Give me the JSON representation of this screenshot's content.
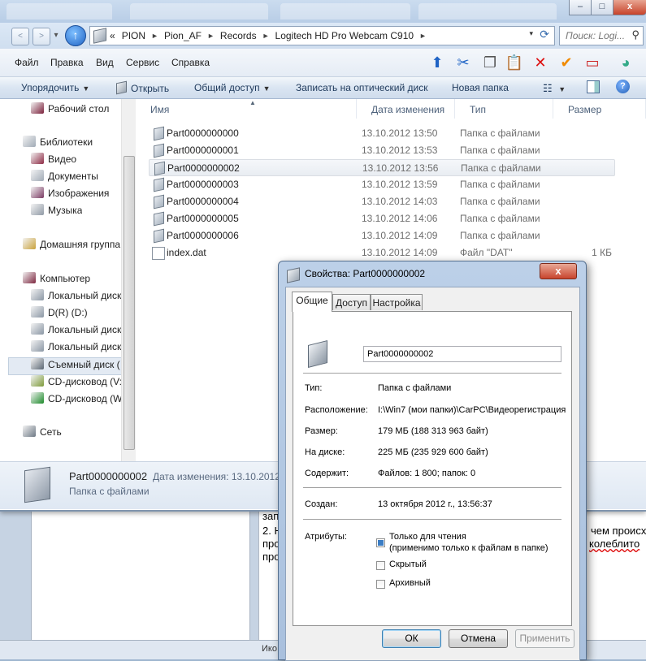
{
  "background_doc": {
    "lines": [
      {
        "text": "зап"
      },
      {
        "text": "2. Н"
      },
      {
        "text": "про"
      },
      {
        "text": "про"
      },
      {
        "text": "чем происх"
      },
      {
        "text": "колеблито"
      }
    ],
    "bottom_snippet": "Ико"
  },
  "window": {
    "caption_buttons": {
      "minimize": "–",
      "maximize": "□",
      "close": "x"
    }
  },
  "address_bar": {
    "back": "<",
    "forward": ">",
    "up": "↑",
    "overflow": "«",
    "crumbs": [
      "PION",
      "Pion_AF",
      "Records",
      "Logitech HD Pro Webcam C910"
    ],
    "search_placeholder": "Поиск: Logi..."
  },
  "menu": {
    "items": [
      "Файл",
      "Правка",
      "Вид",
      "Сервис",
      "Справка"
    ]
  },
  "commandbar": {
    "organize": "Упорядочить",
    "open": "Открыть",
    "share": "Общий доступ",
    "burn": "Записать на оптический диск",
    "new_folder": "Новая папка",
    "help": "?"
  },
  "navigation": {
    "items": [
      {
        "label": "Рабочий стол",
        "icon": "desktop-icon",
        "color": "#7a1f3a"
      },
      {
        "label": "Библиотеки",
        "icon": "libraries-icon",
        "color": "#a0aab6"
      },
      {
        "label": "Видео",
        "icon": "video-icon",
        "color": "#8d2a44"
      },
      {
        "label": "Документы",
        "icon": "documents-icon",
        "color": "#a0aab6"
      },
      {
        "label": "Изображения",
        "icon": "pictures-icon",
        "color": "#7a3a62"
      },
      {
        "label": "Музыка",
        "icon": "music-icon",
        "color": "#909aa6"
      },
      {
        "label": "Домашняя группа",
        "icon": "homegroup-icon",
        "color": "#c9a13a"
      },
      {
        "label": "Компьютер",
        "icon": "computer-icon",
        "color": "#7d2740"
      },
      {
        "label": "Локальный диск",
        "icon": "drive-icon",
        "color": "#8a96a4"
      },
      {
        "label": "D(R) (D:)",
        "icon": "drive-icon",
        "color": "#8a96a4"
      },
      {
        "label": "Локальный диск",
        "icon": "drive-icon",
        "color": "#8a96a4"
      },
      {
        "label": "Локальный диск",
        "icon": "drive-icon",
        "color": "#8a96a4"
      },
      {
        "label": "Съемный диск (",
        "icon": "removable-drive-icon",
        "color": "#5a6673"
      },
      {
        "label": "CD-дисковод (V:",
        "icon": "cd-drive-icon",
        "color": "#7d9a3a"
      },
      {
        "label": "CD-дисковод (W",
        "icon": "cd-drive-icon",
        "color": "#1c8a2a"
      },
      {
        "label": "Сеть",
        "icon": "network-icon",
        "color": "#6d7884"
      }
    ]
  },
  "files": {
    "columns": {
      "name": "Имя",
      "date": "Дата изменения",
      "type": "Тип",
      "size": "Размер"
    },
    "rows": [
      {
        "name": "Part0000000000",
        "date": "13.10.2012 13:50",
        "type": "Папка с файлами",
        "size": ""
      },
      {
        "name": "Part0000000001",
        "date": "13.10.2012 13:53",
        "type": "Папка с файлами",
        "size": ""
      },
      {
        "name": "Part0000000002",
        "date": "13.10.2012 13:56",
        "type": "Папка с файлами",
        "size": ""
      },
      {
        "name": "Part0000000003",
        "date": "13.10.2012 13:59",
        "type": "Папка с файлами",
        "size": ""
      },
      {
        "name": "Part0000000004",
        "date": "13.10.2012 14:03",
        "type": "Папка с файлами",
        "size": ""
      },
      {
        "name": "Part0000000005",
        "date": "13.10.2012 14:06",
        "type": "Папка с файлами",
        "size": ""
      },
      {
        "name": "Part0000000006",
        "date": "13.10.2012 14:09",
        "type": "Папка с файлами",
        "size": ""
      },
      {
        "name": "index.dat",
        "date": "13.10.2012 14:09",
        "type": "Файл \"DAT\"",
        "size": "1 КБ"
      }
    ]
  },
  "details_pane": {
    "name": "Part0000000002",
    "date_label": "Дата изменения: 13.10.2012 1",
    "type": "Папка с файлами"
  },
  "properties": {
    "title": "Свойства: Part0000000002",
    "close": "x",
    "tabs": [
      "Общие",
      "Доступ",
      "Настройка"
    ],
    "name_value": "Part0000000002",
    "fields": [
      {
        "label": "Тип:",
        "value": "Папка с файлами"
      },
      {
        "label": "Расположение:",
        "value": "I:\\Win7 (мои папки)\\CarPC\\Видеорегистрация"
      },
      {
        "label": "Размер:",
        "value": "179 МБ (188 313 963 байт)"
      },
      {
        "label": "На диске:",
        "value": "225 МБ (235 929 600 байт)"
      },
      {
        "label": "Содержит:",
        "value": "Файлов: 1 800; папок: 0"
      }
    ],
    "created_label": "Создан:",
    "created_value": "13 октября 2012 г., 13:56:37",
    "attributes_label": "Атрибуты:",
    "readonly_label": "Только для чтения",
    "readonly_note": "(применимо только к файлам в папке)",
    "hidden_label": "Скрытый",
    "archive_label": "Архивный",
    "buttons": {
      "ok": "ОК",
      "cancel": "Отмена",
      "apply": "Применить"
    }
  }
}
